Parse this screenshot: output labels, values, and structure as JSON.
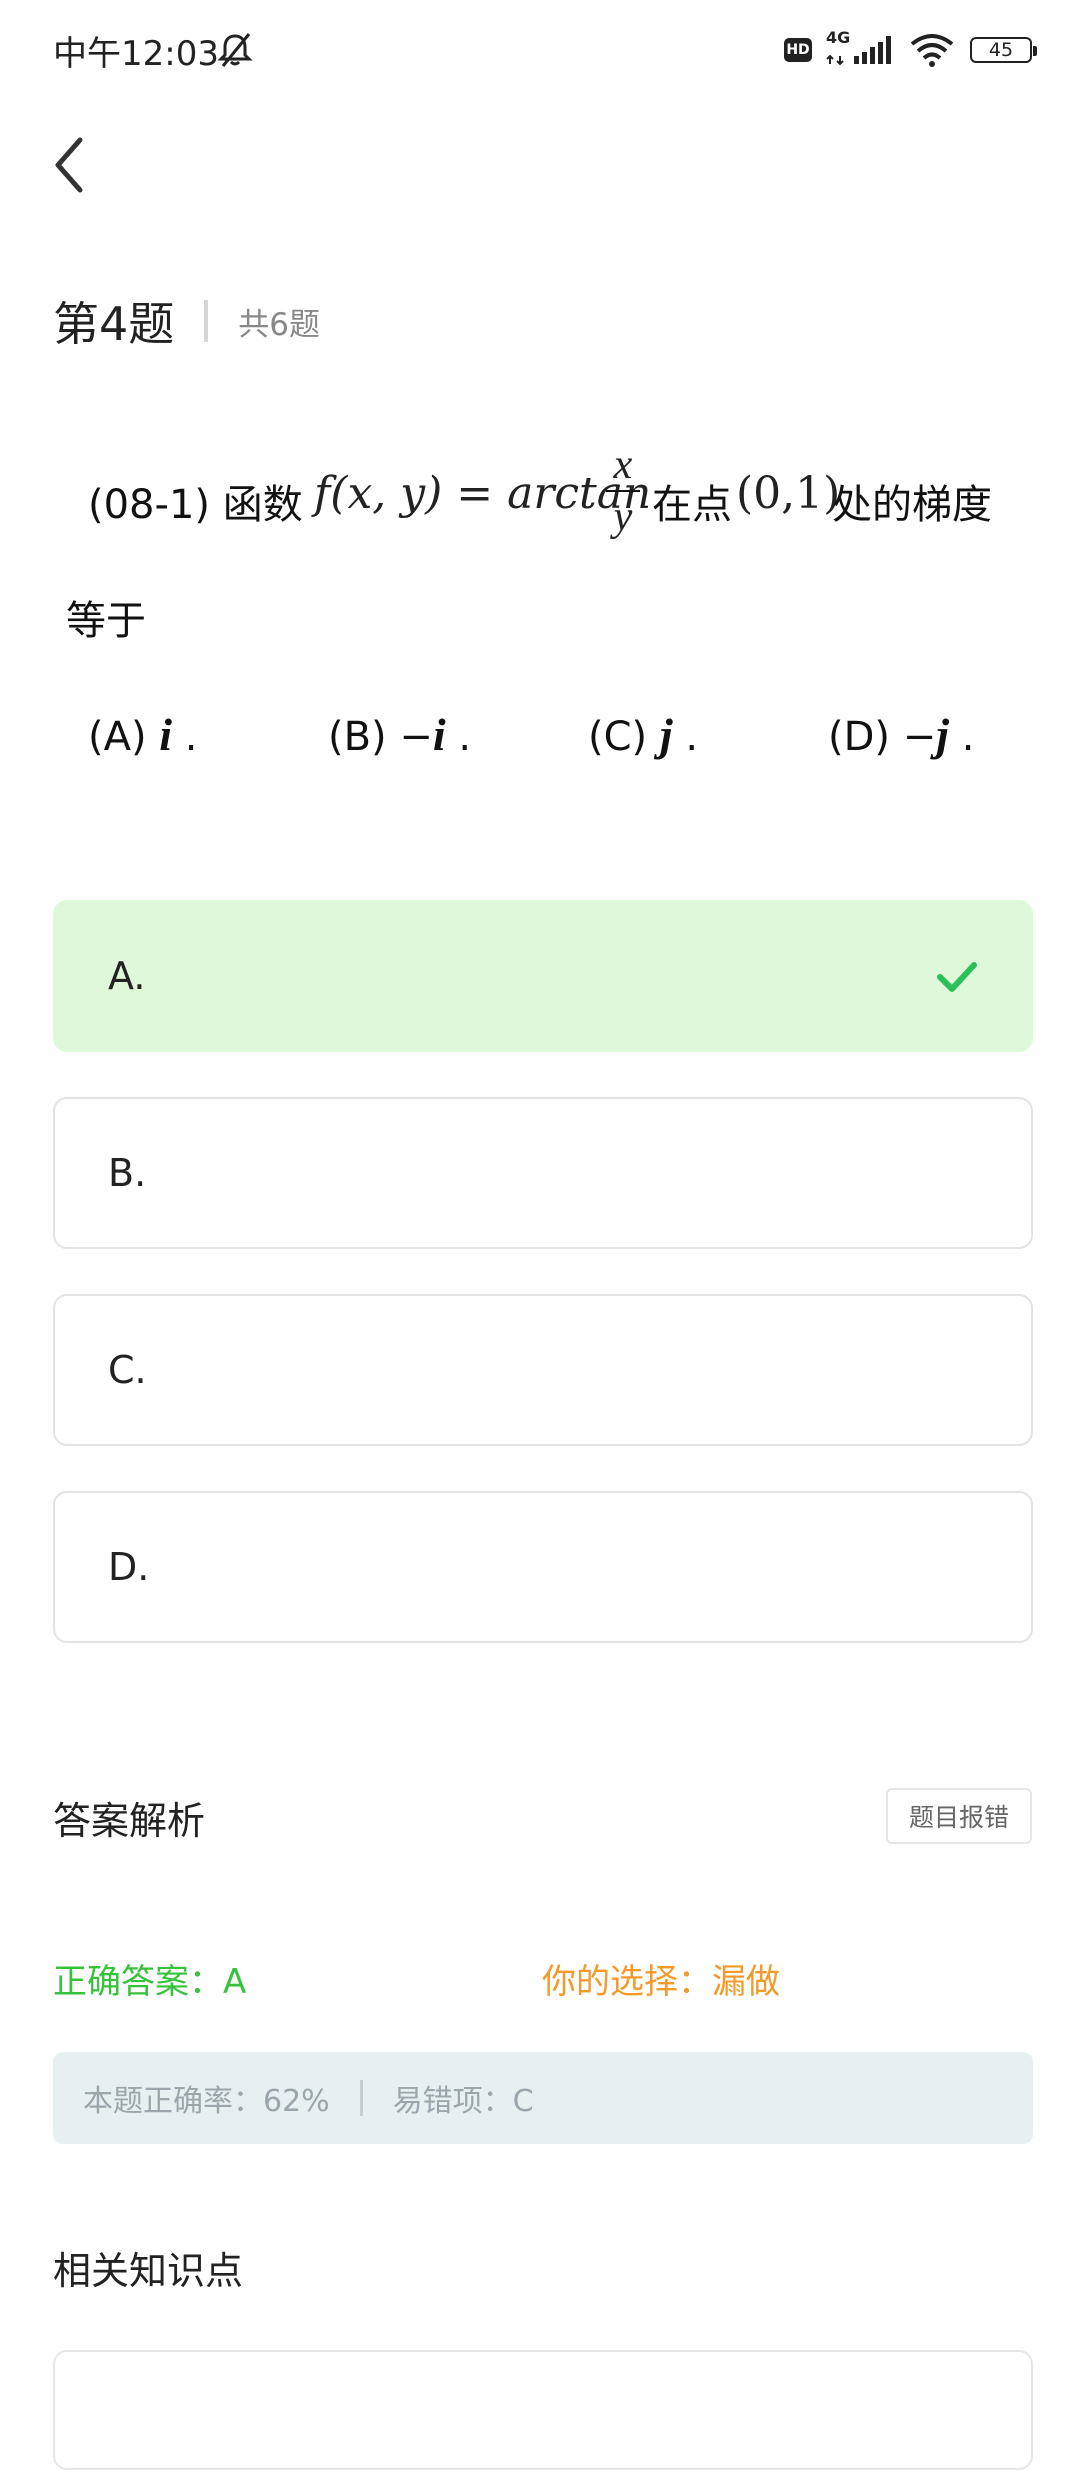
{
  "status": {
    "time": "中午12:03",
    "network": "4G",
    "battery": "45"
  },
  "header": {
    "question_number": "第4题",
    "total": "共6题"
  },
  "question": {
    "prefix": "(08-1) 函数",
    "func": "f(x, y) = arctan",
    "frac_num": "x",
    "frac_den": "y",
    "middle": "在点",
    "point": "(0,1)",
    "suffix": "处的梯度",
    "line2": "等于",
    "choices": [
      {
        "label": "(A)",
        "value": "i",
        "sign": ""
      },
      {
        "label": "(B)",
        "value": "i",
        "sign": "−"
      },
      {
        "label": "(C)",
        "value": "j",
        "sign": ""
      },
      {
        "label": "(D)",
        "value": "j",
        "sign": "−"
      }
    ]
  },
  "options": [
    {
      "label": "A.",
      "state": "correct"
    },
    {
      "label": "B.",
      "state": "normal"
    },
    {
      "label": "C.",
      "state": "normal"
    },
    {
      "label": "D.",
      "state": "normal"
    }
  ],
  "analysis": {
    "title": "答案解析",
    "report_button": "题目报错",
    "correct_answer": "正确答案：A",
    "your_choice": "你的选择：漏做",
    "accuracy": "本题正确率：62%",
    "common_wrong": "易错项：C"
  },
  "knowledge": {
    "title": "相关知识点"
  },
  "colors": {
    "correct_green": "#37c23b",
    "choice_orange": "#f39a2b",
    "correct_bg": "#dff8d9"
  }
}
